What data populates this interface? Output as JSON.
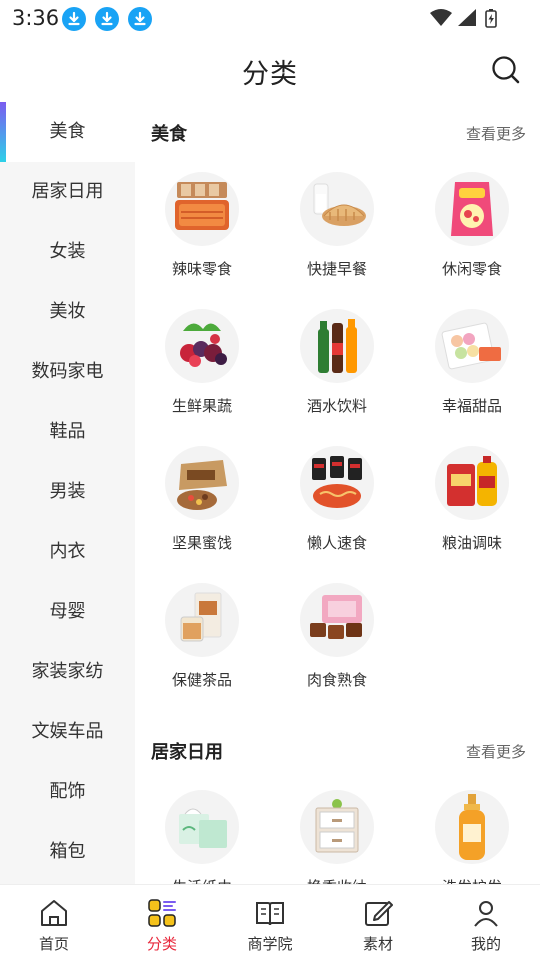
{
  "status_bar": {
    "time": "3:36",
    "download_icons": [
      "download-icon",
      "download-icon",
      "download-icon"
    ],
    "system_icons": [
      "wifi-icon",
      "signal-icon",
      "battery-charging-icon"
    ]
  },
  "header": {
    "title": "分类",
    "search_icon": "search-icon"
  },
  "sidebar": {
    "items": [
      {
        "label": "美食",
        "active": true
      },
      {
        "label": "居家日用"
      },
      {
        "label": "女装"
      },
      {
        "label": "美妆"
      },
      {
        "label": "数码家电"
      },
      {
        "label": "鞋品"
      },
      {
        "label": "男装"
      },
      {
        "label": "内衣"
      },
      {
        "label": "母婴"
      },
      {
        "label": "家装家纺"
      },
      {
        "label": "文娱车品"
      },
      {
        "label": "配饰"
      },
      {
        "label": "箱包"
      }
    ]
  },
  "content": {
    "sections": [
      {
        "title": "美食",
        "more": "查看更多",
        "items": [
          {
            "label": "辣味零食",
            "icon": "spicy-snack-image"
          },
          {
            "label": "快捷早餐",
            "icon": "bread-milk-image"
          },
          {
            "label": "休闲零食",
            "icon": "chips-bag-image"
          },
          {
            "label": "生鲜果蔬",
            "icon": "fruit-image"
          },
          {
            "label": "酒水饮料",
            "icon": "drinks-image"
          },
          {
            "label": "幸福甜品",
            "icon": "macaron-image"
          },
          {
            "label": "坚果蜜饯",
            "icon": "nuts-box-image"
          },
          {
            "label": "懒人速食",
            "icon": "instant-noodle-image"
          },
          {
            "label": "粮油调味",
            "icon": "rice-oil-image"
          },
          {
            "label": "保健茶品",
            "icon": "tea-image"
          },
          {
            "label": "肉食熟食",
            "icon": "braised-meat-image"
          }
        ]
      },
      {
        "title": "居家日用",
        "more": "查看更多",
        "items": [
          {
            "label": "生活纸巾",
            "icon": "tissue-image"
          },
          {
            "label": "换季收纳",
            "icon": "storage-drawer-image"
          },
          {
            "label": "洗发护发",
            "icon": "shampoo-image"
          }
        ]
      }
    ]
  },
  "bottom_nav": {
    "items": [
      {
        "label": "首页",
        "icon": "home-icon"
      },
      {
        "label": "分类",
        "icon": "category-icon",
        "active": true
      },
      {
        "label": "商学院",
        "icon": "book-icon"
      },
      {
        "label": "素材",
        "icon": "edit-icon"
      },
      {
        "label": "我的",
        "icon": "profile-icon"
      }
    ]
  },
  "colors": {
    "accent": "#e8283c",
    "download": "#19a3f5",
    "sidebar_bg": "#f6f6f6",
    "gradient_top": "#7b5cf0",
    "gradient_bottom": "#2dd1e8"
  }
}
